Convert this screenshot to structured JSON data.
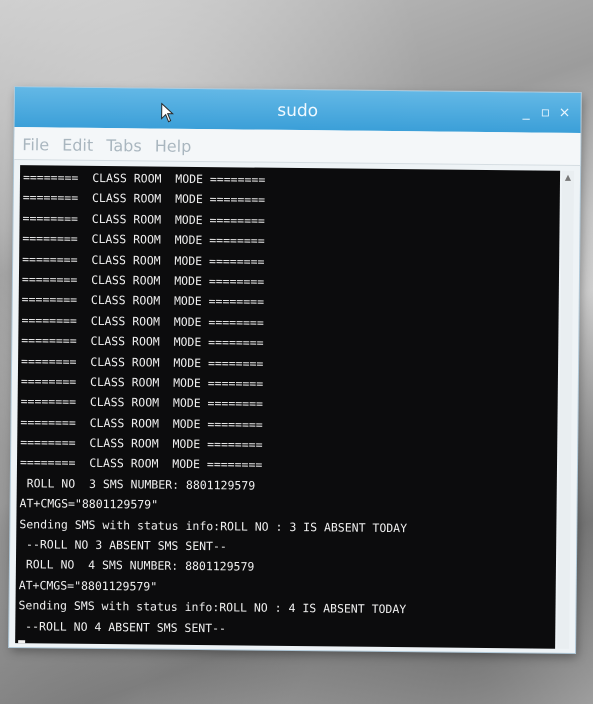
{
  "window": {
    "title": "sudo",
    "controls": [
      "_",
      "▫",
      "×"
    ]
  },
  "menu": [
    "File",
    "Edit",
    "Tabs",
    "Help"
  ],
  "terminal": {
    "lines": [
      "========  CLASS ROOM  MODE ========",
      "========  CLASS ROOM  MODE ========",
      "========  CLASS ROOM  MODE ========",
      "========  CLASS ROOM  MODE ========",
      "========  CLASS ROOM  MODE ========",
      "========  CLASS ROOM  MODE ========",
      "========  CLASS ROOM  MODE ========",
      "========  CLASS ROOM  MODE ========",
      "========  CLASS ROOM  MODE ========",
      "========  CLASS ROOM  MODE ========",
      "========  CLASS ROOM  MODE ========",
      "========  CLASS ROOM  MODE ========",
      "========  CLASS ROOM  MODE ========",
      "========  CLASS ROOM  MODE ========",
      "========  CLASS ROOM  MODE ========",
      " ROLL NO  3 SMS NUMBER: 8801129579",
      "AT+CMGS=\"8801129579\"",
      "Sending SMS with status info:ROLL NO : 3 IS ABSENT TODAY",
      " --ROLL NO 3 ABSENT SMS SENT--",
      " ROLL NO  4 SMS NUMBER: 8801129579",
      "AT+CMGS=\"8801129579\"",
      "Sending SMS with status info:ROLL NO : 4 IS ABSENT TODAY",
      " --ROLL NO 4 ABSENT SMS SENT--"
    ]
  },
  "icons": {
    "cursor": "mouse-pointer-icon",
    "scroll_up": "scroll-up-arrow-icon"
  }
}
